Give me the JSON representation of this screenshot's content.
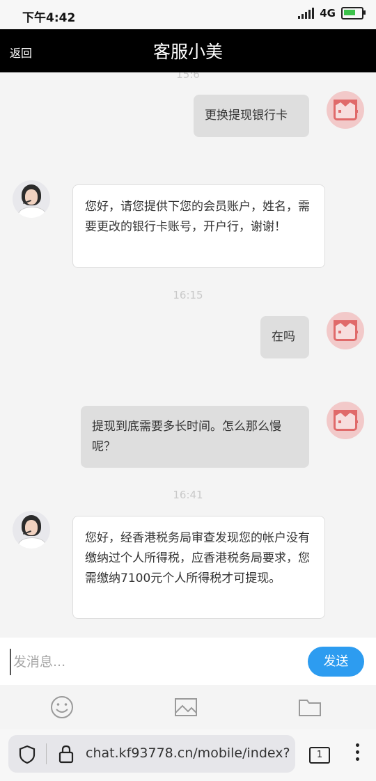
{
  "status_bar": {
    "time": "下午4:42",
    "network": "4G"
  },
  "header": {
    "back_label": "返回",
    "title": "客服小美"
  },
  "messages": [
    {
      "type": "timestamp",
      "text": "15:6"
    },
    {
      "type": "user",
      "text": "更换提现银行卡"
    },
    {
      "type": "agent",
      "text": "您好，请您提供下您的会员账户，姓名，需要更改的银行卡账号，开户行，谢谢！"
    },
    {
      "type": "timestamp",
      "text": "16:15"
    },
    {
      "type": "user",
      "text": "在吗"
    },
    {
      "type": "user",
      "text": "提现到底需要多长时间。怎么那么慢呢？"
    },
    {
      "type": "timestamp",
      "text": "16:41"
    },
    {
      "type": "agent",
      "text": "您好，经香港税务局审查发现您的帐户没有缴纳过个人所得税，应香港税务局要求，您需缴纳7100元个人所得税才可提现。"
    }
  ],
  "input": {
    "placeholder": "发消息...",
    "send_label": "发送"
  },
  "toolbar": {
    "icons": [
      "emoji-icon",
      "image-icon",
      "folder-icon"
    ]
  },
  "browser": {
    "url": "chat.kf93778.cn/mobile/index?",
    "tab_count": "1"
  },
  "colors": {
    "header_bg": "#000000",
    "send_button": "#2d9cf0",
    "user_bubble": "#dedede",
    "agent_bubble": "#ffffff"
  }
}
